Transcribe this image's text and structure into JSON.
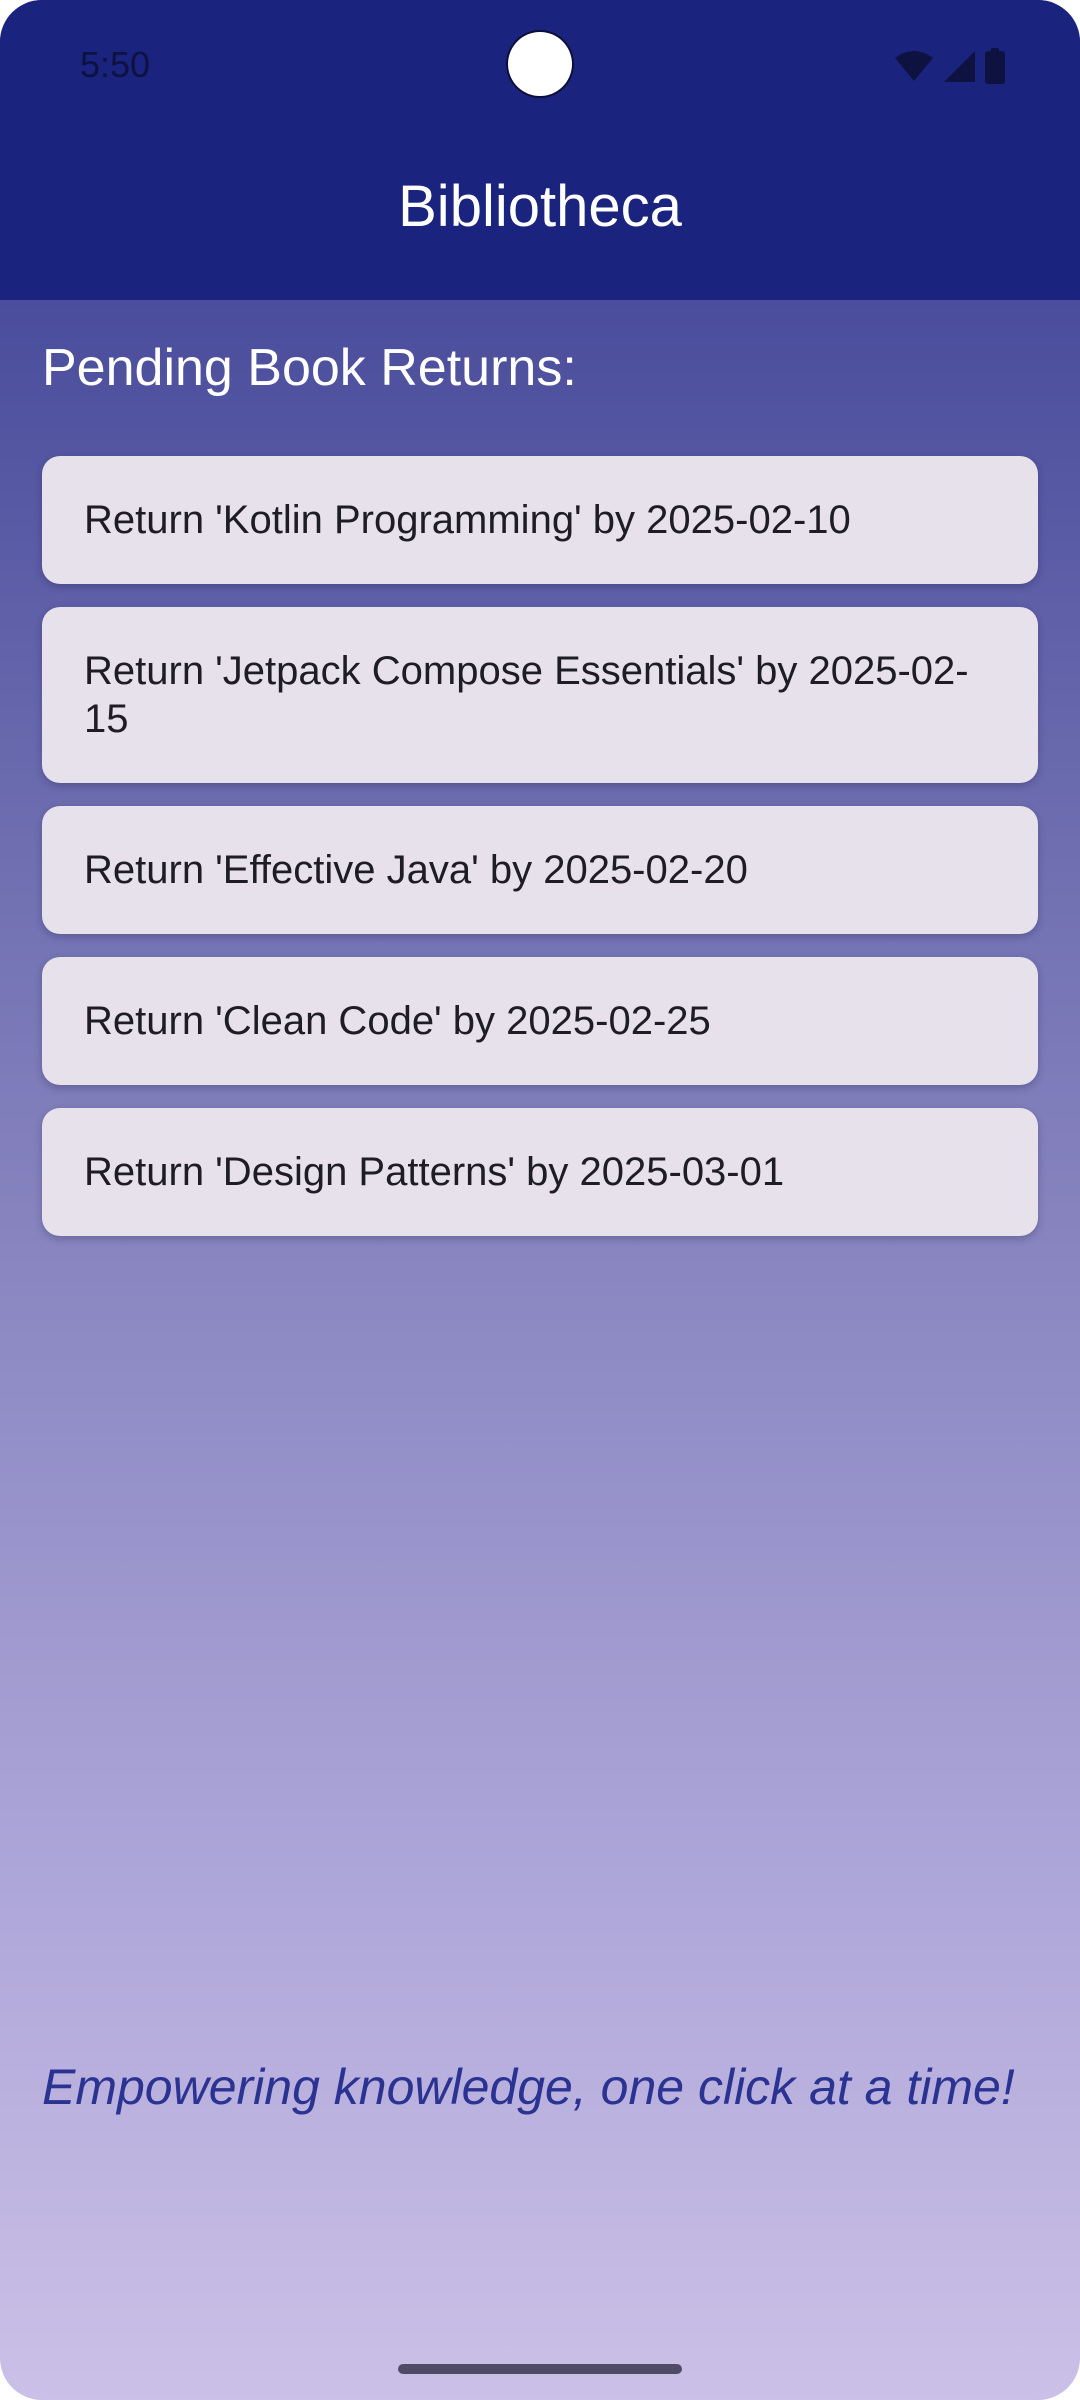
{
  "status_bar": {
    "time": "5:50",
    "icons": [
      "wifi-icon",
      "cellular-signal-icon",
      "battery-icon"
    ]
  },
  "app": {
    "title": "Bibliotheca",
    "brand_color": "#1a237e"
  },
  "main": {
    "section_title": "Pending Book Returns:",
    "returns": [
      "Return 'Kotlin Programming' by 2025-02-10",
      "Return 'Jetpack Compose Essentials' by 2025-02-15",
      "Return 'Effective Java' by 2025-02-20",
      "Return 'Clean Code' by 2025-02-25",
      "Return 'Design Patterns' by 2025-03-01"
    ],
    "tagline": "Empowering knowledge, one click at a time!"
  }
}
